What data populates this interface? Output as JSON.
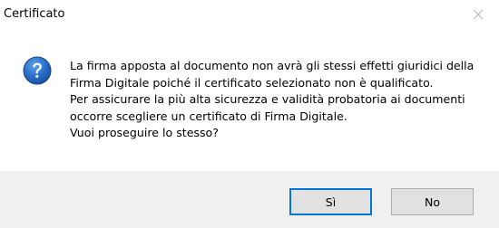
{
  "window": {
    "title": "Certificato",
    "close_icon": "close-icon"
  },
  "dialog": {
    "icon": "question-icon",
    "icon_color": "#1f62b5",
    "message_lines": [
      "La firma apposta al documento non avrà gli stessi effetti giuridici della",
      "Firma Digitale poiché il certificato selezionato non è qualificato.",
      "Per assicurare la più alta sicurezza e validità probatoria ai documenti",
      "occorre scegliere un certificato di Firma Digitale.",
      "Vuoi proseguire lo stesso?"
    ]
  },
  "buttons": {
    "yes_label": "Sì",
    "no_label": "No",
    "default_button": "Sì",
    "accent_color": "#0078d7"
  }
}
